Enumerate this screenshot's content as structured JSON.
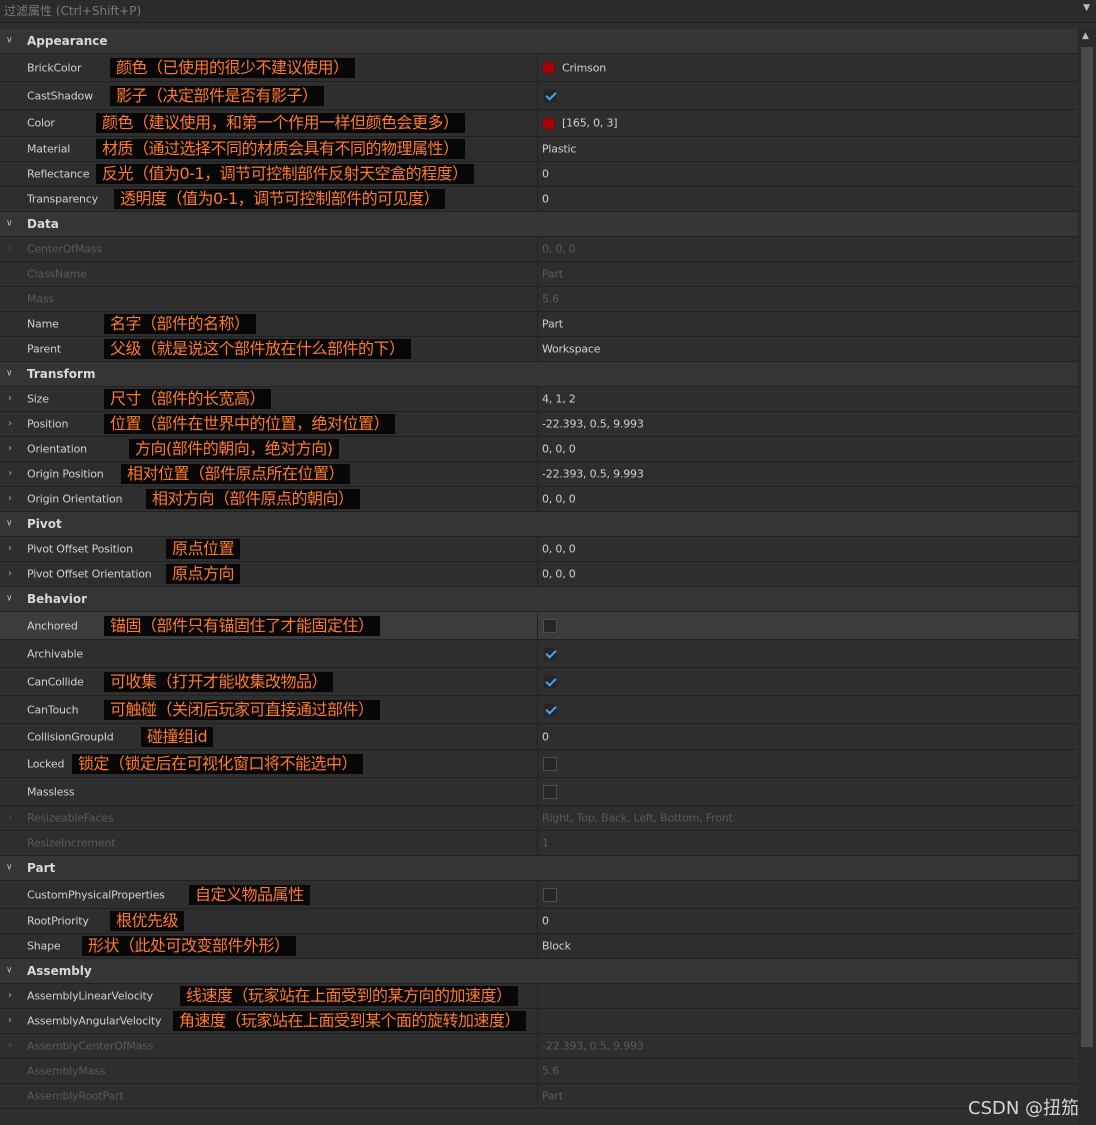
{
  "filter": {
    "placeholder": "过滤属性 (Ctrl+Shift+P)"
  },
  "colors": {
    "crimson": "#a50003",
    "annotation_text": "#ff7a2a",
    "checkmark": "#4aa3e8"
  },
  "icons": {
    "collapse": "chevron-down-icon",
    "expand": "chevron-right-icon",
    "check": "check-icon"
  },
  "rows": [
    {
      "type": "header",
      "label": "Appearance"
    },
    {
      "type": "prop",
      "name": "BrickColor",
      "value": "Crimson",
      "swatch": "#a50003",
      "note": "颜色（已使用的很少不建议使用）"
    },
    {
      "type": "prop",
      "name": "CastShadow",
      "check": true,
      "note": "影子（决定部件是否有影子）"
    },
    {
      "type": "prop",
      "name": "Color",
      "value": "[165, 0, 3]",
      "swatch": "#a50003",
      "note": "颜色（建议使用，和第一个作用一样但颜色会更多）"
    },
    {
      "type": "prop",
      "name": "Material",
      "value": "Plastic",
      "note": "材质（通过选择不同的材质会具有不同的物理属性）"
    },
    {
      "type": "prop",
      "name": "Reflectance",
      "value": "0",
      "note": "反光（值为0-1，调节可控制部件反射天空盒的程度）"
    },
    {
      "type": "prop",
      "name": "Transparency",
      "value": "0",
      "note": "透明度（值为0-1，调节可控制部件的可见度）"
    },
    {
      "type": "header",
      "label": "Data"
    },
    {
      "type": "prop",
      "name": "CenterOfMass",
      "value": "0, 0, 0",
      "expand": true,
      "disabled": true
    },
    {
      "type": "prop",
      "name": "ClassName",
      "value": "Part",
      "disabled": true
    },
    {
      "type": "prop",
      "name": "Mass",
      "value": "5.6",
      "disabled": true
    },
    {
      "type": "prop",
      "name": "Name",
      "value": "Part",
      "note": "名字（部件的名称）"
    },
    {
      "type": "prop",
      "name": "Parent",
      "value": "Workspace",
      "note": "父级（就是说这个部件放在什么部件的下）"
    },
    {
      "type": "header",
      "label": "Transform"
    },
    {
      "type": "prop",
      "name": "Size",
      "value": "4, 1, 2",
      "expand": true,
      "note": "尺寸（部件的长宽高）"
    },
    {
      "type": "prop",
      "name": "Position",
      "value": "-22.393, 0.5, 9.993",
      "expand": true,
      "note": "位置（部件在世界中的位置，绝对位置）"
    },
    {
      "type": "prop",
      "name": "Orientation",
      "value": "0, 0, 0",
      "expand": true,
      "note": "方向(部件的朝向，绝对方向)"
    },
    {
      "type": "prop",
      "name": "Origin Position",
      "value": "-22.393, 0.5, 9.993",
      "expand": true,
      "note": "相对位置（部件原点所在位置）"
    },
    {
      "type": "prop",
      "name": "Origin Orientation",
      "value": "0, 0, 0",
      "expand": true,
      "note": "相对方向（部件原点的朝向）"
    },
    {
      "type": "header",
      "label": "Pivot"
    },
    {
      "type": "prop",
      "name": "Pivot Offset Position",
      "value": "0, 0, 0",
      "expand": true,
      "note": "原点位置"
    },
    {
      "type": "prop",
      "name": "Pivot Offset Orientation",
      "value": "0, 0, 0",
      "expand": true,
      "note": "原点方向"
    },
    {
      "type": "header",
      "label": "Behavior"
    },
    {
      "type": "prop",
      "name": "Anchored",
      "check": false,
      "selected": true,
      "note": "锚固（部件只有锚固住了才能固定住）"
    },
    {
      "type": "prop",
      "name": "Archivable",
      "check": true
    },
    {
      "type": "prop",
      "name": "CanCollide",
      "check": true,
      "note": "可收集（打开才能收集改物品）"
    },
    {
      "type": "prop",
      "name": "CanTouch",
      "check": true,
      "note": "可触碰（关闭后玩家可直接通过部件）"
    },
    {
      "type": "prop",
      "name": "CollisionGroupId",
      "value": "0",
      "note": "碰撞组id"
    },
    {
      "type": "prop",
      "name": "Locked",
      "check": false,
      "note": "锁定（锁定后在可视化窗口将不能选中）"
    },
    {
      "type": "prop",
      "name": "Massless",
      "check": false
    },
    {
      "type": "prop",
      "name": "ResizeableFaces",
      "value": "Right, Top, Back, Left, Bottom, Front",
      "expand": true,
      "disabled": true
    },
    {
      "type": "prop",
      "name": "ResizeIncrement",
      "value": "1",
      "disabled": true
    },
    {
      "type": "header",
      "label": "Part"
    },
    {
      "type": "prop",
      "name": "CustomPhysicalProperties",
      "check": false,
      "note": "自定义物品属性"
    },
    {
      "type": "prop",
      "name": "RootPriority",
      "value": "0",
      "note": "根优先级"
    },
    {
      "type": "prop",
      "name": "Shape",
      "value": "Block",
      "note": "形状（此处可改变部件外形）"
    },
    {
      "type": "header",
      "label": "Assembly"
    },
    {
      "type": "prop",
      "name": "AssemblyLinearVelocity",
      "value": "",
      "expand": true,
      "note": "线速度（玩家站在上面受到的某方向的加速度）"
    },
    {
      "type": "prop",
      "name": "AssemblyAngularVelocity",
      "value": "",
      "expand": true,
      "note": "角速度（玩家站在上面受到某个面的旋转加速度）"
    },
    {
      "type": "prop",
      "name": "AssemblyCenterOfMass",
      "value": "-22.393, 0.5, 9.993",
      "expand": true,
      "disabled": true
    },
    {
      "type": "prop",
      "name": "AssemblyMass",
      "value": "5.6",
      "disabled": true
    },
    {
      "type": "prop",
      "name": "AssemblyRootPart",
      "value": "Part",
      "disabled": true
    }
  ],
  "watermark": "CSDN @扭笳"
}
